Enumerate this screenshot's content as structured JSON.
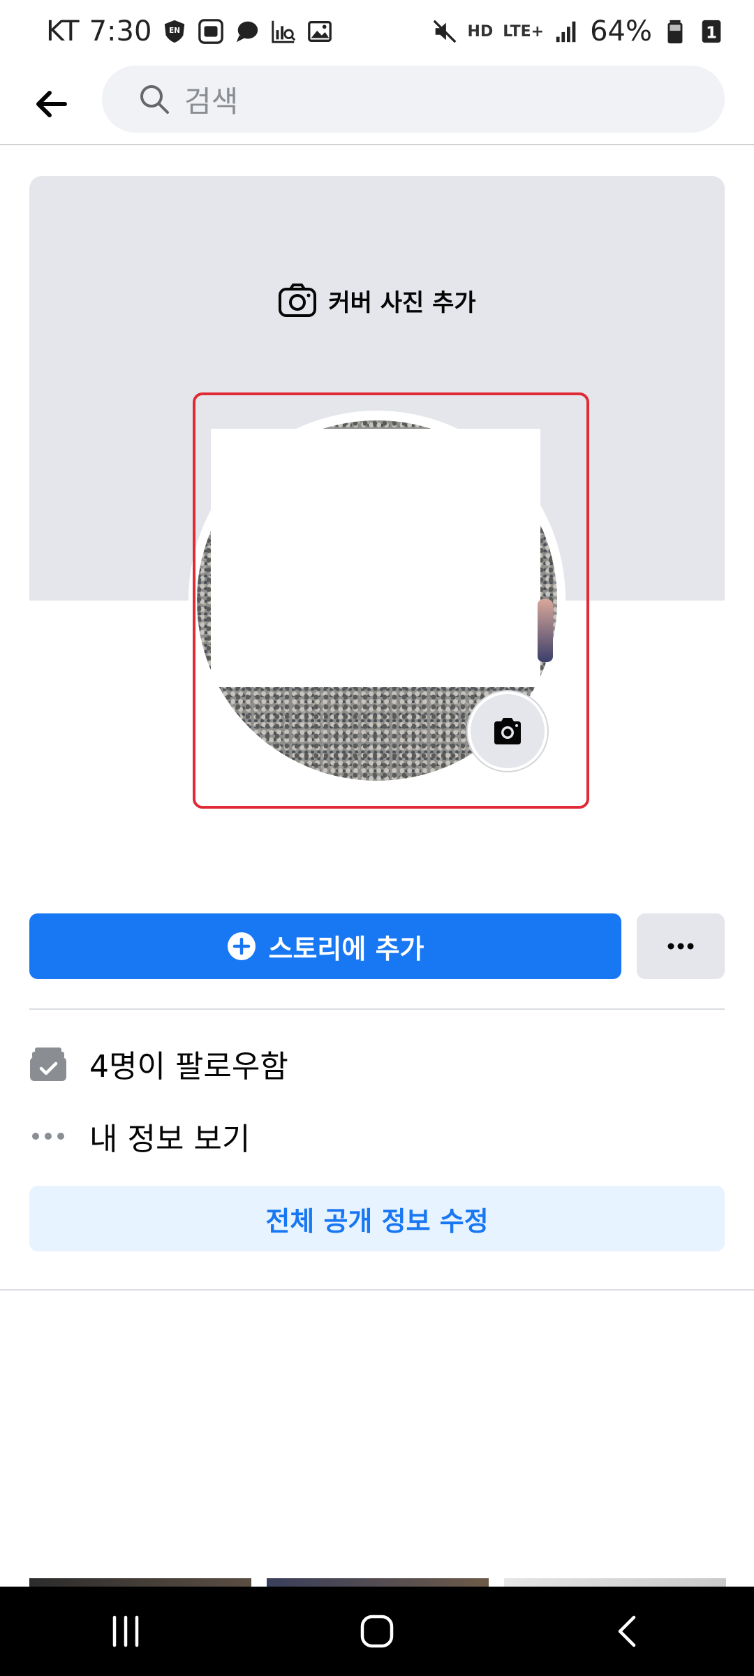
{
  "status_bar": {
    "carrier": "KT",
    "time": "7:30",
    "en_badge": "EN",
    "network_type": "LTE+",
    "hd_badge": "HD",
    "battery_percent": "64%",
    "sim_slot": "1"
  },
  "search": {
    "placeholder": "검색"
  },
  "cover": {
    "add_cover_label": "커버 사진 추가"
  },
  "actions": {
    "add_story_label": "스토리에 추가"
  },
  "info": {
    "followers_label": "4명이 팔로우함",
    "about_label": "내 정보 보기"
  },
  "edit_public": {
    "label": "전체 공개 정보 수정"
  },
  "colors": {
    "primary": "#1877f2",
    "highlight": "#e02b36",
    "surface": "#e4e6eb"
  },
  "icons": {
    "back": "arrow-left",
    "search": "magnifier",
    "cover_camera": "camera-outline",
    "profile_camera": "camera-filled",
    "add_story": "plus-circle",
    "more": "ellipsis",
    "followers": "followers-stack",
    "about": "dots",
    "nav_recent": "recent-apps",
    "nav_home": "home",
    "nav_back": "back-chevron"
  }
}
